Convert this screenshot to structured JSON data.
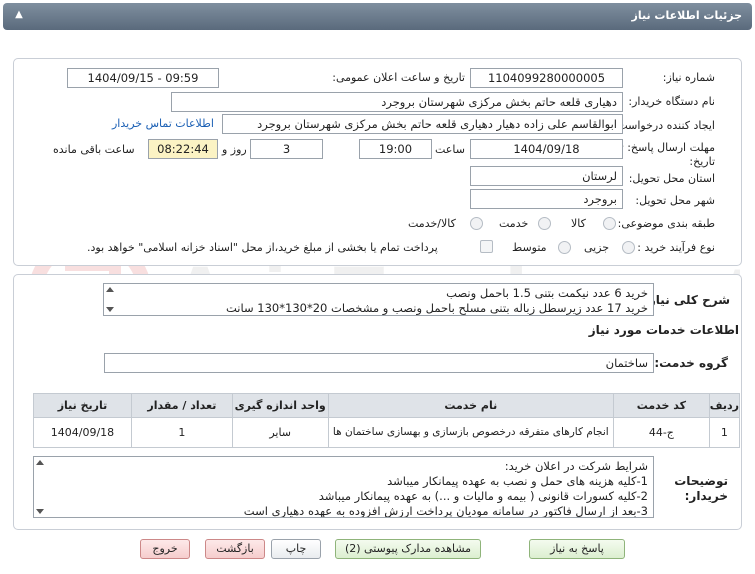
{
  "header": {
    "title": "جزئیات اطلاعات نیاز",
    "toggle_icon": "chevron-up-icon"
  },
  "form": {
    "need_number_label": "شماره نیاز:",
    "need_number": "1104099280000005",
    "announce_label": "تاریخ و ساعت اعلان عمومی:",
    "announce_value": "1404/09/15 - 09:59",
    "buyer_label": "نام دستگاه خریدار:",
    "buyer_value": "دهیاری قلعه حاتم بخش مرکزی شهرستان بروجرد",
    "creator_label": "ایجاد کننده درخواست:",
    "creator_value": "ابوالقاسم علی زاده دهیار دهیاری قلعه حاتم بخش مرکزی شهرستان بروجرد",
    "contact_link": "اطلاعات تماس خریدار",
    "deadline_label_1": "مهلت ارسال پاسخ: تا",
    "deadline_label_2": "تاریخ:",
    "deadline_date": "1404/09/18",
    "time_label": "ساعت",
    "deadline_time": "19:00",
    "days_value": "3",
    "days_label": "روز و",
    "remaining_time": "08:22:44",
    "remaining_label": "ساعت باقی مانده",
    "province_label": "استان محل تحویل:",
    "province_value": "لرستان",
    "city_label": "شهر محل تحویل:",
    "city_value": "بروجرد",
    "category_label": "طبقه بندی موضوعی:",
    "category_options": [
      "کالا",
      "خدمت",
      "کالا/خدمت"
    ],
    "process_label": "نوع فرآیند خرید :",
    "process_options": [
      "جزیی",
      "متوسط"
    ],
    "payment_note": "پرداخت تمام یا بخشی از مبلغ خرید،از محل \"اسناد خزانه اسلامی\" خواهد بود."
  },
  "details": {
    "summary_label": "شرح کلی نیاز:",
    "summary_lines": [
      "خرید 6 عدد نیکمت بتنی 1.5 باحمل ونصب",
      "خرید 17 عدد زیرسطل زباله بتنی مسلح باحمل ونصب و مشخصات 20*130*130 سانت"
    ],
    "services_title": "اطلاعات خدمات مورد نیاز",
    "service_group_label": "گروه خدمت:",
    "service_group_value": "ساختمان",
    "table": {
      "headers": [
        "ردیف",
        "کد خدمت",
        "نام خدمت",
        "واحد اندازه گیری",
        "تعداد / مقدار",
        "تاریخ نیاز"
      ],
      "rows": [
        [
          "1",
          "ج-44",
          "انجام کارهای متفرقه درخصوص بازسازی و بهسازی ساختمان ها",
          "سایر",
          "1",
          "1404/09/18"
        ]
      ]
    },
    "buyer_notes_label_1": "توضیحات",
    "buyer_notes_label_2": "خریدار:",
    "buyer_notes_lines": [
      "شرایط شرکت در اعلان خرید:",
      "1-کلیه هزینه های حمل و نصب به عهده پیمانکار میباشد",
      "2-کلیه کسورات قانونی ( بیمه و مالیات و ...) به عهده پیمانکار میباشد",
      "3-بعد از ارسال فاکتور در سامانه مودیان پرداخت ارزش افزوده به عهده دهیاری است"
    ]
  },
  "buttons": {
    "reply": "پاسخ به نیاز",
    "view_docs": "مشاهده مدارک پیوستی (2)",
    "print": "چاپ",
    "back": "بازگشت",
    "exit": "خروج"
  },
  "watermark": {
    "text": "AriaTender.net"
  }
}
